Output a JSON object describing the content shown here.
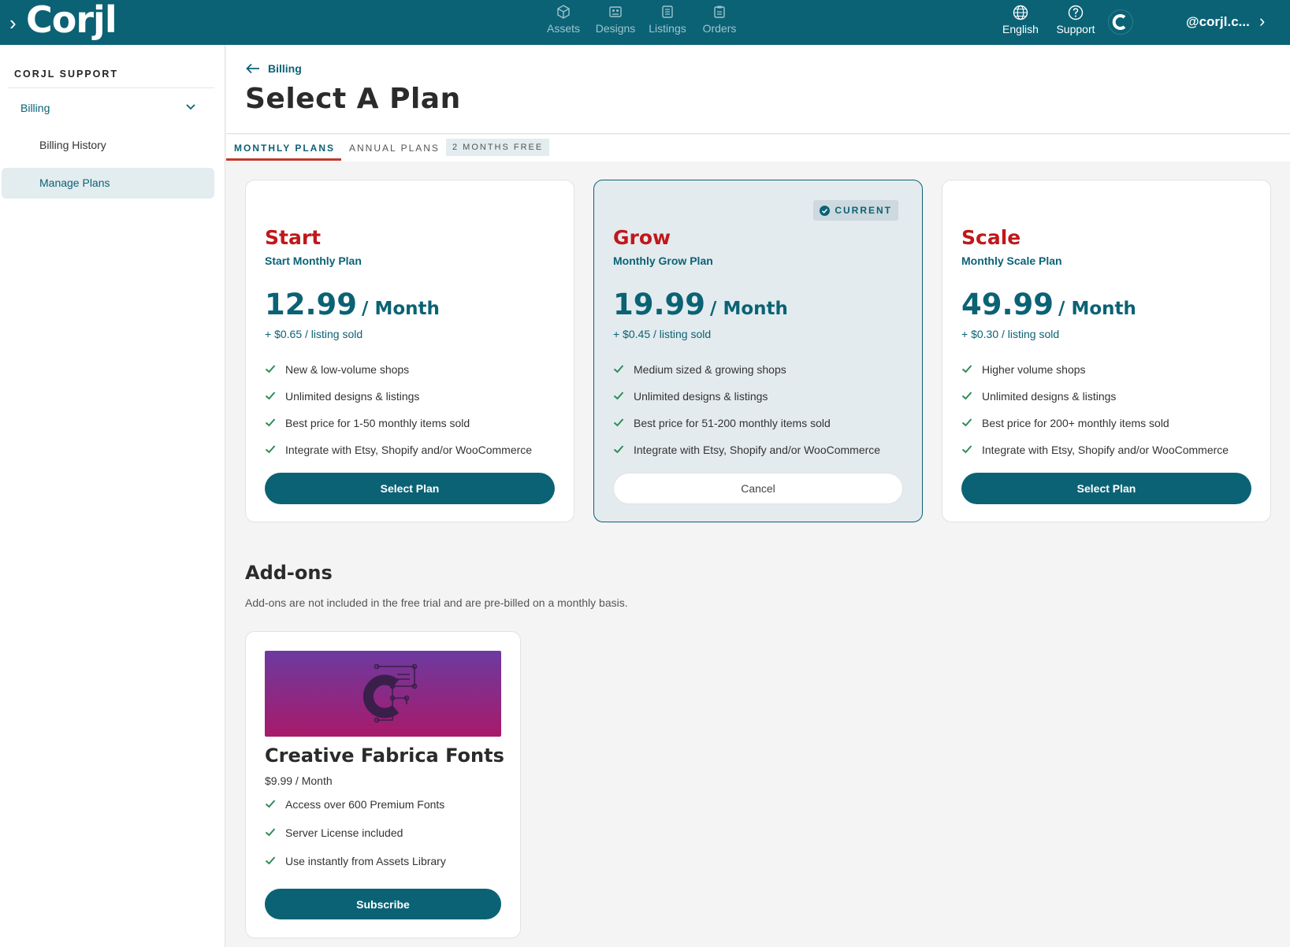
{
  "app": {
    "logo": "Corjl",
    "expand_glyph": "›"
  },
  "nav": [
    {
      "label": "Assets",
      "icon": "cube-icon"
    },
    {
      "label": "Designs",
      "icon": "designs-icon"
    },
    {
      "label": "Listings",
      "icon": "listings-icon"
    },
    {
      "label": "Orders",
      "icon": "orders-icon"
    }
  ],
  "header_right": {
    "language": "English",
    "support": "Support",
    "user": "@corjl.c...",
    "user_chev": "›"
  },
  "sidebar": {
    "title": "CORJL SUPPORT",
    "section": "Billing",
    "items": [
      {
        "label": "Billing History",
        "active": false
      },
      {
        "label": "Manage Plans",
        "active": true
      }
    ]
  },
  "page": {
    "back_label": "Billing",
    "title": "Select A Plan"
  },
  "tabs": {
    "monthly": "MONTHLY PLANS",
    "annual": "ANNUAL PLANS",
    "annual_badge": "2 MONTHS FREE"
  },
  "plans": [
    {
      "name": "Start",
      "subtitle": "Start Monthly Plan",
      "price": "12.99",
      "period": "/ Month",
      "fee": "+ $0.65 / listing sold",
      "features": [
        "New & low-volume shops",
        "Unlimited designs & listings",
        "Best price for 1-50 monthly items sold",
        "Integrate with Etsy, Shopify and/or WooCommerce"
      ],
      "button": "Select Plan",
      "current": false
    },
    {
      "name": "Grow",
      "subtitle": "Monthly Grow Plan",
      "price": "19.99",
      "period": "/ Month",
      "fee": "+ $0.45 / listing sold",
      "features": [
        "Medium sized & growing shops",
        "Unlimited designs & listings",
        "Best price for 51-200 monthly items sold",
        "Integrate with Etsy, Shopify and/or WooCommerce"
      ],
      "button": "Cancel",
      "current": true,
      "badge": "CURRENT"
    },
    {
      "name": "Scale",
      "subtitle": "Monthly Scale Plan",
      "price": "49.99",
      "period": "/ Month",
      "fee": "+ $0.30 / listing sold",
      "features": [
        "Higher volume shops",
        "Unlimited designs & listings",
        "Best price for 200+ monthly items sold",
        "Integrate with Etsy, Shopify and/or WooCommerce"
      ],
      "button": "Select Plan",
      "current": false
    }
  ],
  "addons": {
    "title": "Add-ons",
    "description": "Add-ons are not included in the free trial and are pre-billed on a monthly basis.",
    "items": [
      {
        "name": "Creative Fabrica Fonts",
        "price": "$9.99 / Month",
        "features": [
          "Access over 600 Premium Fonts",
          "Server License included",
          "Use instantly from Assets Library"
        ],
        "button": "Subscribe"
      }
    ]
  },
  "colors": {
    "brand": "#0b6275",
    "plan_name": "#c0181b",
    "check": "#2e8b57"
  }
}
